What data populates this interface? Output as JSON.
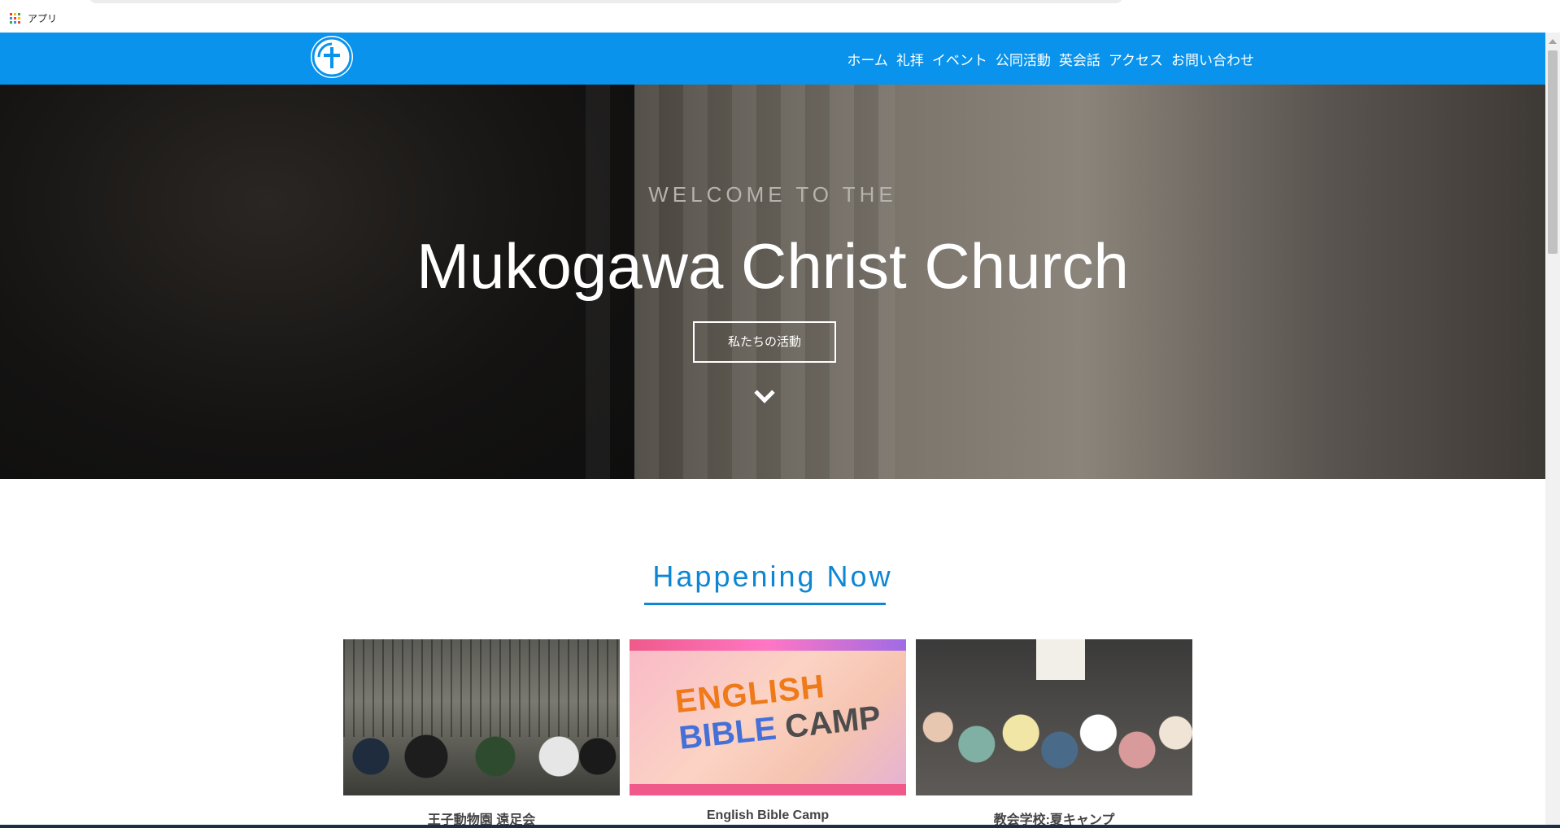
{
  "browser": {
    "bookmarks": {
      "apps_label": "アプリ"
    }
  },
  "header": {
    "nav": [
      "ホーム",
      "礼拝",
      "イベント",
      "公同活動",
      "英会話",
      "アクセス",
      "お問い合わせ"
    ]
  },
  "hero": {
    "welcome": "WELCOME TO THE",
    "title": "Mukogawa Christ Church",
    "cta_label": "私たちの活動"
  },
  "happening": {
    "heading": "Happening Now",
    "cards": [
      {
        "title": "王子動物園 遠足会"
      },
      {
        "title": "English Bible Camp",
        "image_text": {
          "line1": "ENGLISH",
          "line2a": "BIBLE",
          "line2b": "CAMP"
        }
      },
      {
        "title": "教会学校:夏キャンプ"
      }
    ]
  },
  "colors": {
    "brand": "#0993ec",
    "accent": "#0d86d4"
  }
}
